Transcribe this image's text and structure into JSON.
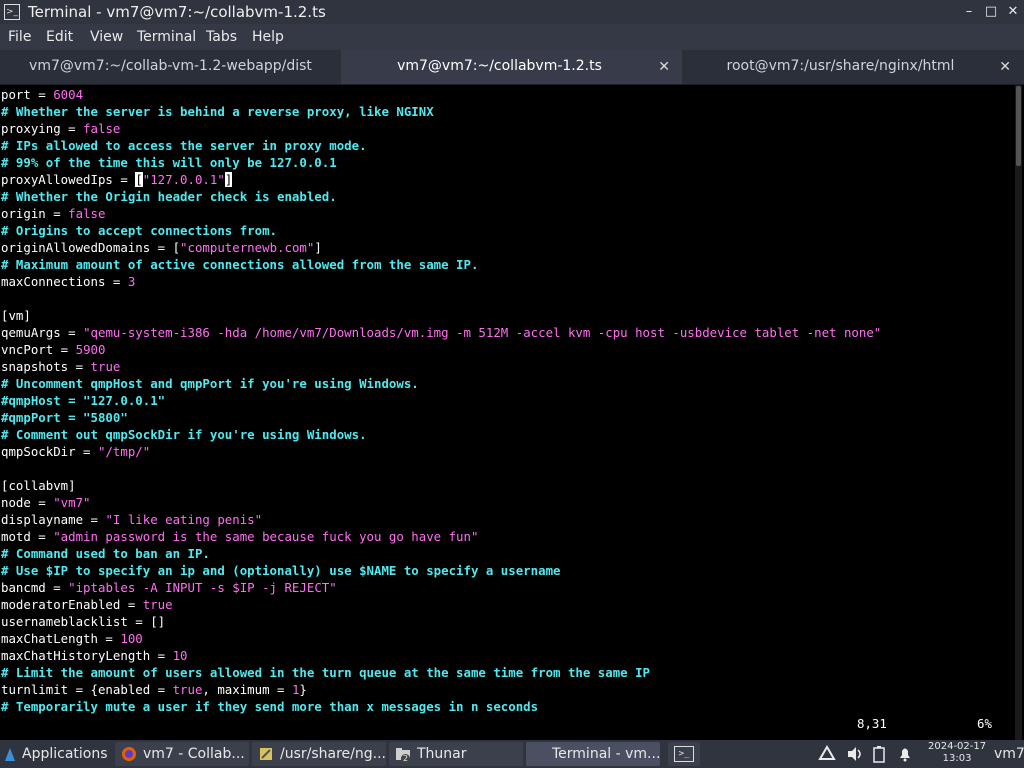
{
  "window": {
    "title": "Terminal - vm7@vm7:~/collabvm-1.2.ts",
    "app_icon_glyph": ">_",
    "minimize_icon": "–",
    "maximize_icon": "□",
    "close_icon": "✕"
  },
  "menu": [
    "File",
    "Edit",
    "View",
    "Terminal",
    "Tabs",
    "Help"
  ],
  "tabs": [
    {
      "label": "vm7@vm7:~/collab-vm-1.2-webapp/dist",
      "active": false
    },
    {
      "label": "vm7@vm7:~/collabvm-1.2.ts",
      "active": true,
      "close": "✕"
    },
    {
      "label": "root@vm7:/usr/share/nginx/html",
      "active": false,
      "close": "✕"
    }
  ],
  "editor": {
    "colors": {
      "comment": "#4fe9ef",
      "key": "#ffffff",
      "value": "#ff6ff0"
    },
    "lines": [
      [
        {
          "t": "port = ",
          "s": "k"
        },
        {
          "t": "6004",
          "s": "v"
        }
      ],
      [
        {
          "t": "# Whether the server is behind a reverse proxy, like NGINX",
          "s": "c"
        }
      ],
      [
        {
          "t": "proxying = ",
          "s": "k"
        },
        {
          "t": "false",
          "s": "v"
        }
      ],
      [
        {
          "t": "# IPs allowed to access the server in proxy mode.",
          "s": "c"
        }
      ],
      [
        {
          "t": "# 99% of the time this will only be 127.0.0.1",
          "s": "c"
        }
      ],
      [
        {
          "t": "proxyAllowedIps = ",
          "s": "k"
        },
        {
          "t": "[",
          "s": "cur"
        },
        {
          "t": "\"127.0.0.1\"",
          "s": "v"
        },
        {
          "t": "]",
          "s": "cur"
        }
      ],
      [
        {
          "t": "# Whether the Origin header check is enabled.",
          "s": "c"
        }
      ],
      [
        {
          "t": "origin = ",
          "s": "k"
        },
        {
          "t": "false",
          "s": "v"
        }
      ],
      [
        {
          "t": "# Origins to accept connections from.",
          "s": "c"
        }
      ],
      [
        {
          "t": "originAllowedDomains = [",
          "s": "k"
        },
        {
          "t": "\"computernewb.com\"",
          "s": "v"
        },
        {
          "t": "]",
          "s": "k"
        }
      ],
      [
        {
          "t": "# Maximum amount of active connections allowed from the same IP.",
          "s": "c"
        }
      ],
      [
        {
          "t": "maxConnections = ",
          "s": "k"
        },
        {
          "t": "3",
          "s": "v"
        }
      ],
      [
        {
          "t": "",
          "s": "k"
        }
      ],
      [
        {
          "t": "[vm]",
          "s": "k"
        }
      ],
      [
        {
          "t": "qemuArgs = ",
          "s": "k"
        },
        {
          "t": "\"qemu-system-i386 -hda /home/vm7/Downloads/vm.img -m 512M -accel kvm -cpu host -usbdevice tablet -net none\"",
          "s": "v"
        }
      ],
      [
        {
          "t": "vncPort = ",
          "s": "k"
        },
        {
          "t": "5900",
          "s": "v"
        }
      ],
      [
        {
          "t": "snapshots = ",
          "s": "k"
        },
        {
          "t": "true",
          "s": "v"
        }
      ],
      [
        {
          "t": "# Uncomment qmpHost and qmpPort if you're using Windows.",
          "s": "c"
        }
      ],
      [
        {
          "t": "#qmpHost = \"127.0.0.1\"",
          "s": "c"
        }
      ],
      [
        {
          "t": "#qmpPort = \"5800\"",
          "s": "c"
        }
      ],
      [
        {
          "t": "# Comment out qmpSockDir if you're using Windows.",
          "s": "c"
        }
      ],
      [
        {
          "t": "qmpSockDir = ",
          "s": "k"
        },
        {
          "t": "\"/tmp/\"",
          "s": "v"
        }
      ],
      [
        {
          "t": "",
          "s": "k"
        }
      ],
      [
        {
          "t": "[collabvm]",
          "s": "k"
        }
      ],
      [
        {
          "t": "node = ",
          "s": "k"
        },
        {
          "t": "\"vm7\"",
          "s": "v"
        }
      ],
      [
        {
          "t": "displayname = ",
          "s": "k"
        },
        {
          "t": "\"I like eating penis\"",
          "s": "v"
        }
      ],
      [
        {
          "t": "motd = ",
          "s": "k"
        },
        {
          "t": "\"admin password is the same because fuck you go have fun\"",
          "s": "v"
        }
      ],
      [
        {
          "t": "# Command used to ban an IP.",
          "s": "c"
        }
      ],
      [
        {
          "t": "# Use $IP to specify an ip and (optionally) use $NAME to specify a username",
          "s": "c"
        }
      ],
      [
        {
          "t": "bancmd = ",
          "s": "k"
        },
        {
          "t": "\"iptables -A INPUT -s $IP -j REJECT\"",
          "s": "v"
        }
      ],
      [
        {
          "t": "moderatorEnabled = ",
          "s": "k"
        },
        {
          "t": "true",
          "s": "v"
        }
      ],
      [
        {
          "t": "usernameblacklist = []",
          "s": "k"
        }
      ],
      [
        {
          "t": "maxChatLength = ",
          "s": "k"
        },
        {
          "t": "100",
          "s": "v"
        }
      ],
      [
        {
          "t": "maxChatHistoryLength = ",
          "s": "k"
        },
        {
          "t": "10",
          "s": "v"
        }
      ],
      [
        {
          "t": "# Limit the amount of users allowed in the turn queue at the same time from the same IP",
          "s": "c"
        }
      ],
      [
        {
          "t": "turnlimit = {enabled = ",
          "s": "k"
        },
        {
          "t": "true",
          "s": "v"
        },
        {
          "t": ", maximum = ",
          "s": "k"
        },
        {
          "t": "1",
          "s": "v"
        },
        {
          "t": "}",
          "s": "k"
        }
      ],
      [
        {
          "t": "# Temporarily mute a user if they send more than x messages in n seconds",
          "s": "c"
        }
      ]
    ],
    "cursor_position": "8,31",
    "scroll_percent": "6%"
  },
  "taskbar": {
    "applications_label": "Applications",
    "windows": [
      {
        "label": "vm7 - Collab...",
        "icon": "firefox-icon"
      },
      {
        "label": "/usr/share/ng...",
        "icon": "text-editor-icon"
      },
      {
        "label": "Thunar",
        "icon": "folder-icon",
        "badge": "2"
      },
      {
        "label": "Terminal - vm...",
        "icon": "terminal-icon",
        "active": true
      }
    ],
    "quick_terminal_icon": ">_",
    "clock_date": "2024-02-17",
    "clock_time": "13:03",
    "user": "vm7"
  }
}
